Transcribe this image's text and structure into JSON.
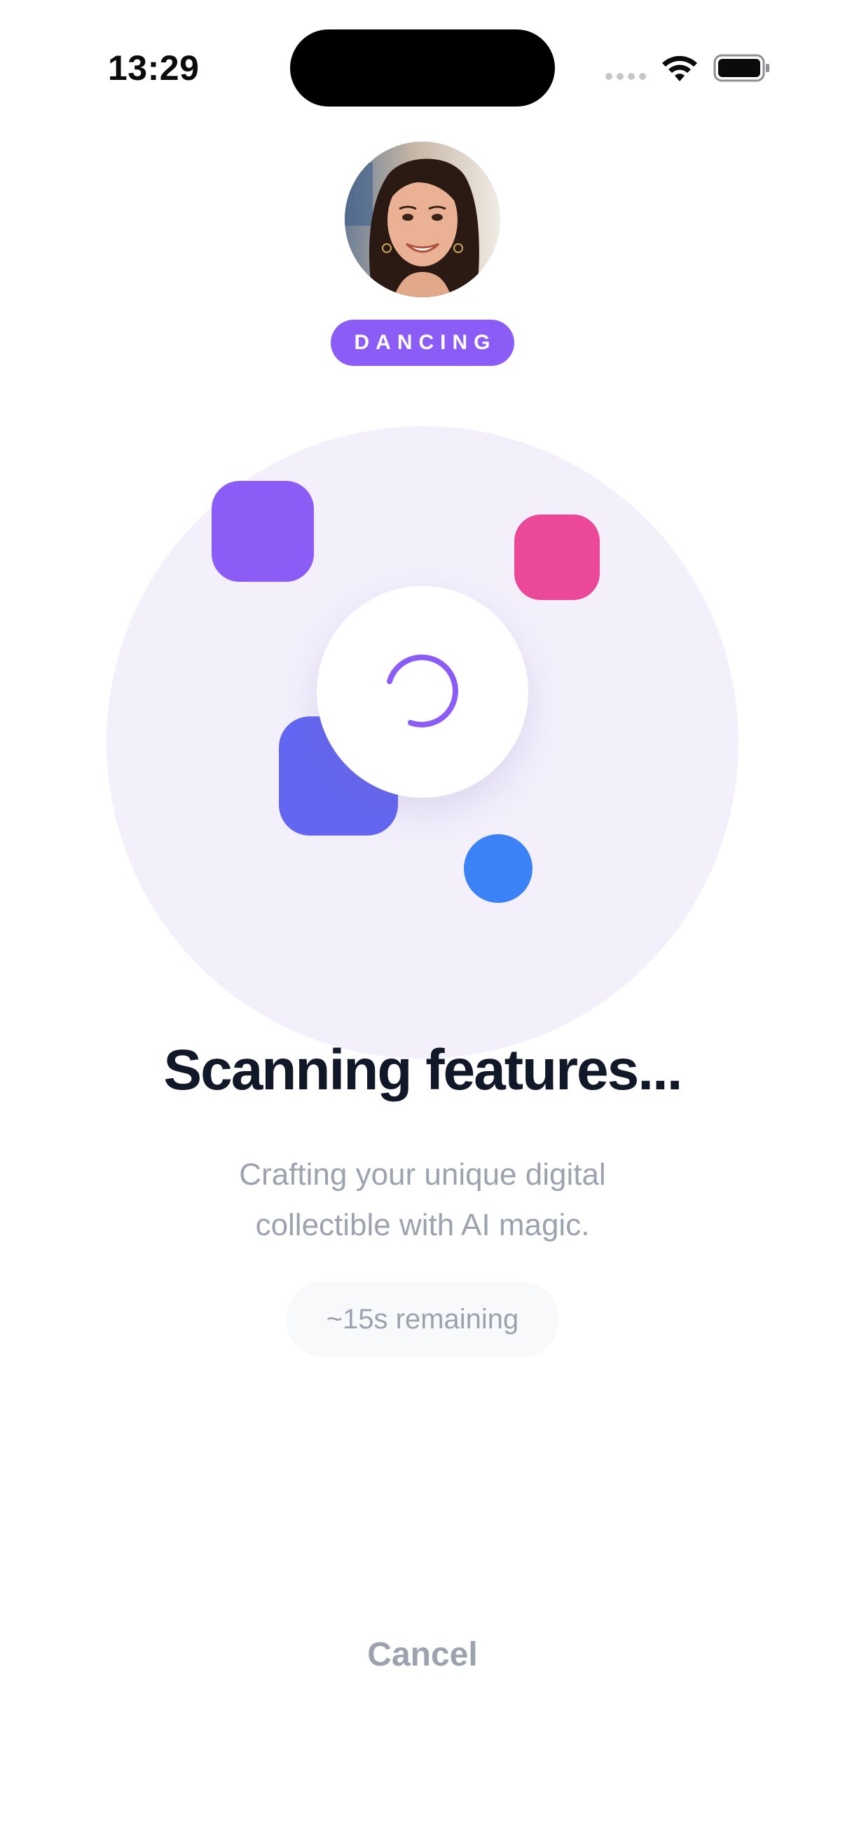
{
  "status_bar": {
    "time": "13:29",
    "icons": [
      "signal-dots-icon",
      "wifi-icon",
      "battery-icon"
    ]
  },
  "profile": {
    "avatar": "portrait-photo",
    "style_tag": "DANCING"
  },
  "illustration": {
    "spinner": "loading-spinner-icon",
    "colors": {
      "disc": "#f3f0fc",
      "purple": "#8b5cf6",
      "pink": "#ec4899",
      "indigo": "#6366f1",
      "blue": "#3b82f6"
    }
  },
  "progress": {
    "title": "Scanning features...",
    "subtitle_line1": "Crafting your unique digital",
    "subtitle_line2": "collectible with AI magic.",
    "remaining": "~15s remaining"
  },
  "actions": {
    "cancel_label": "Cancel"
  }
}
